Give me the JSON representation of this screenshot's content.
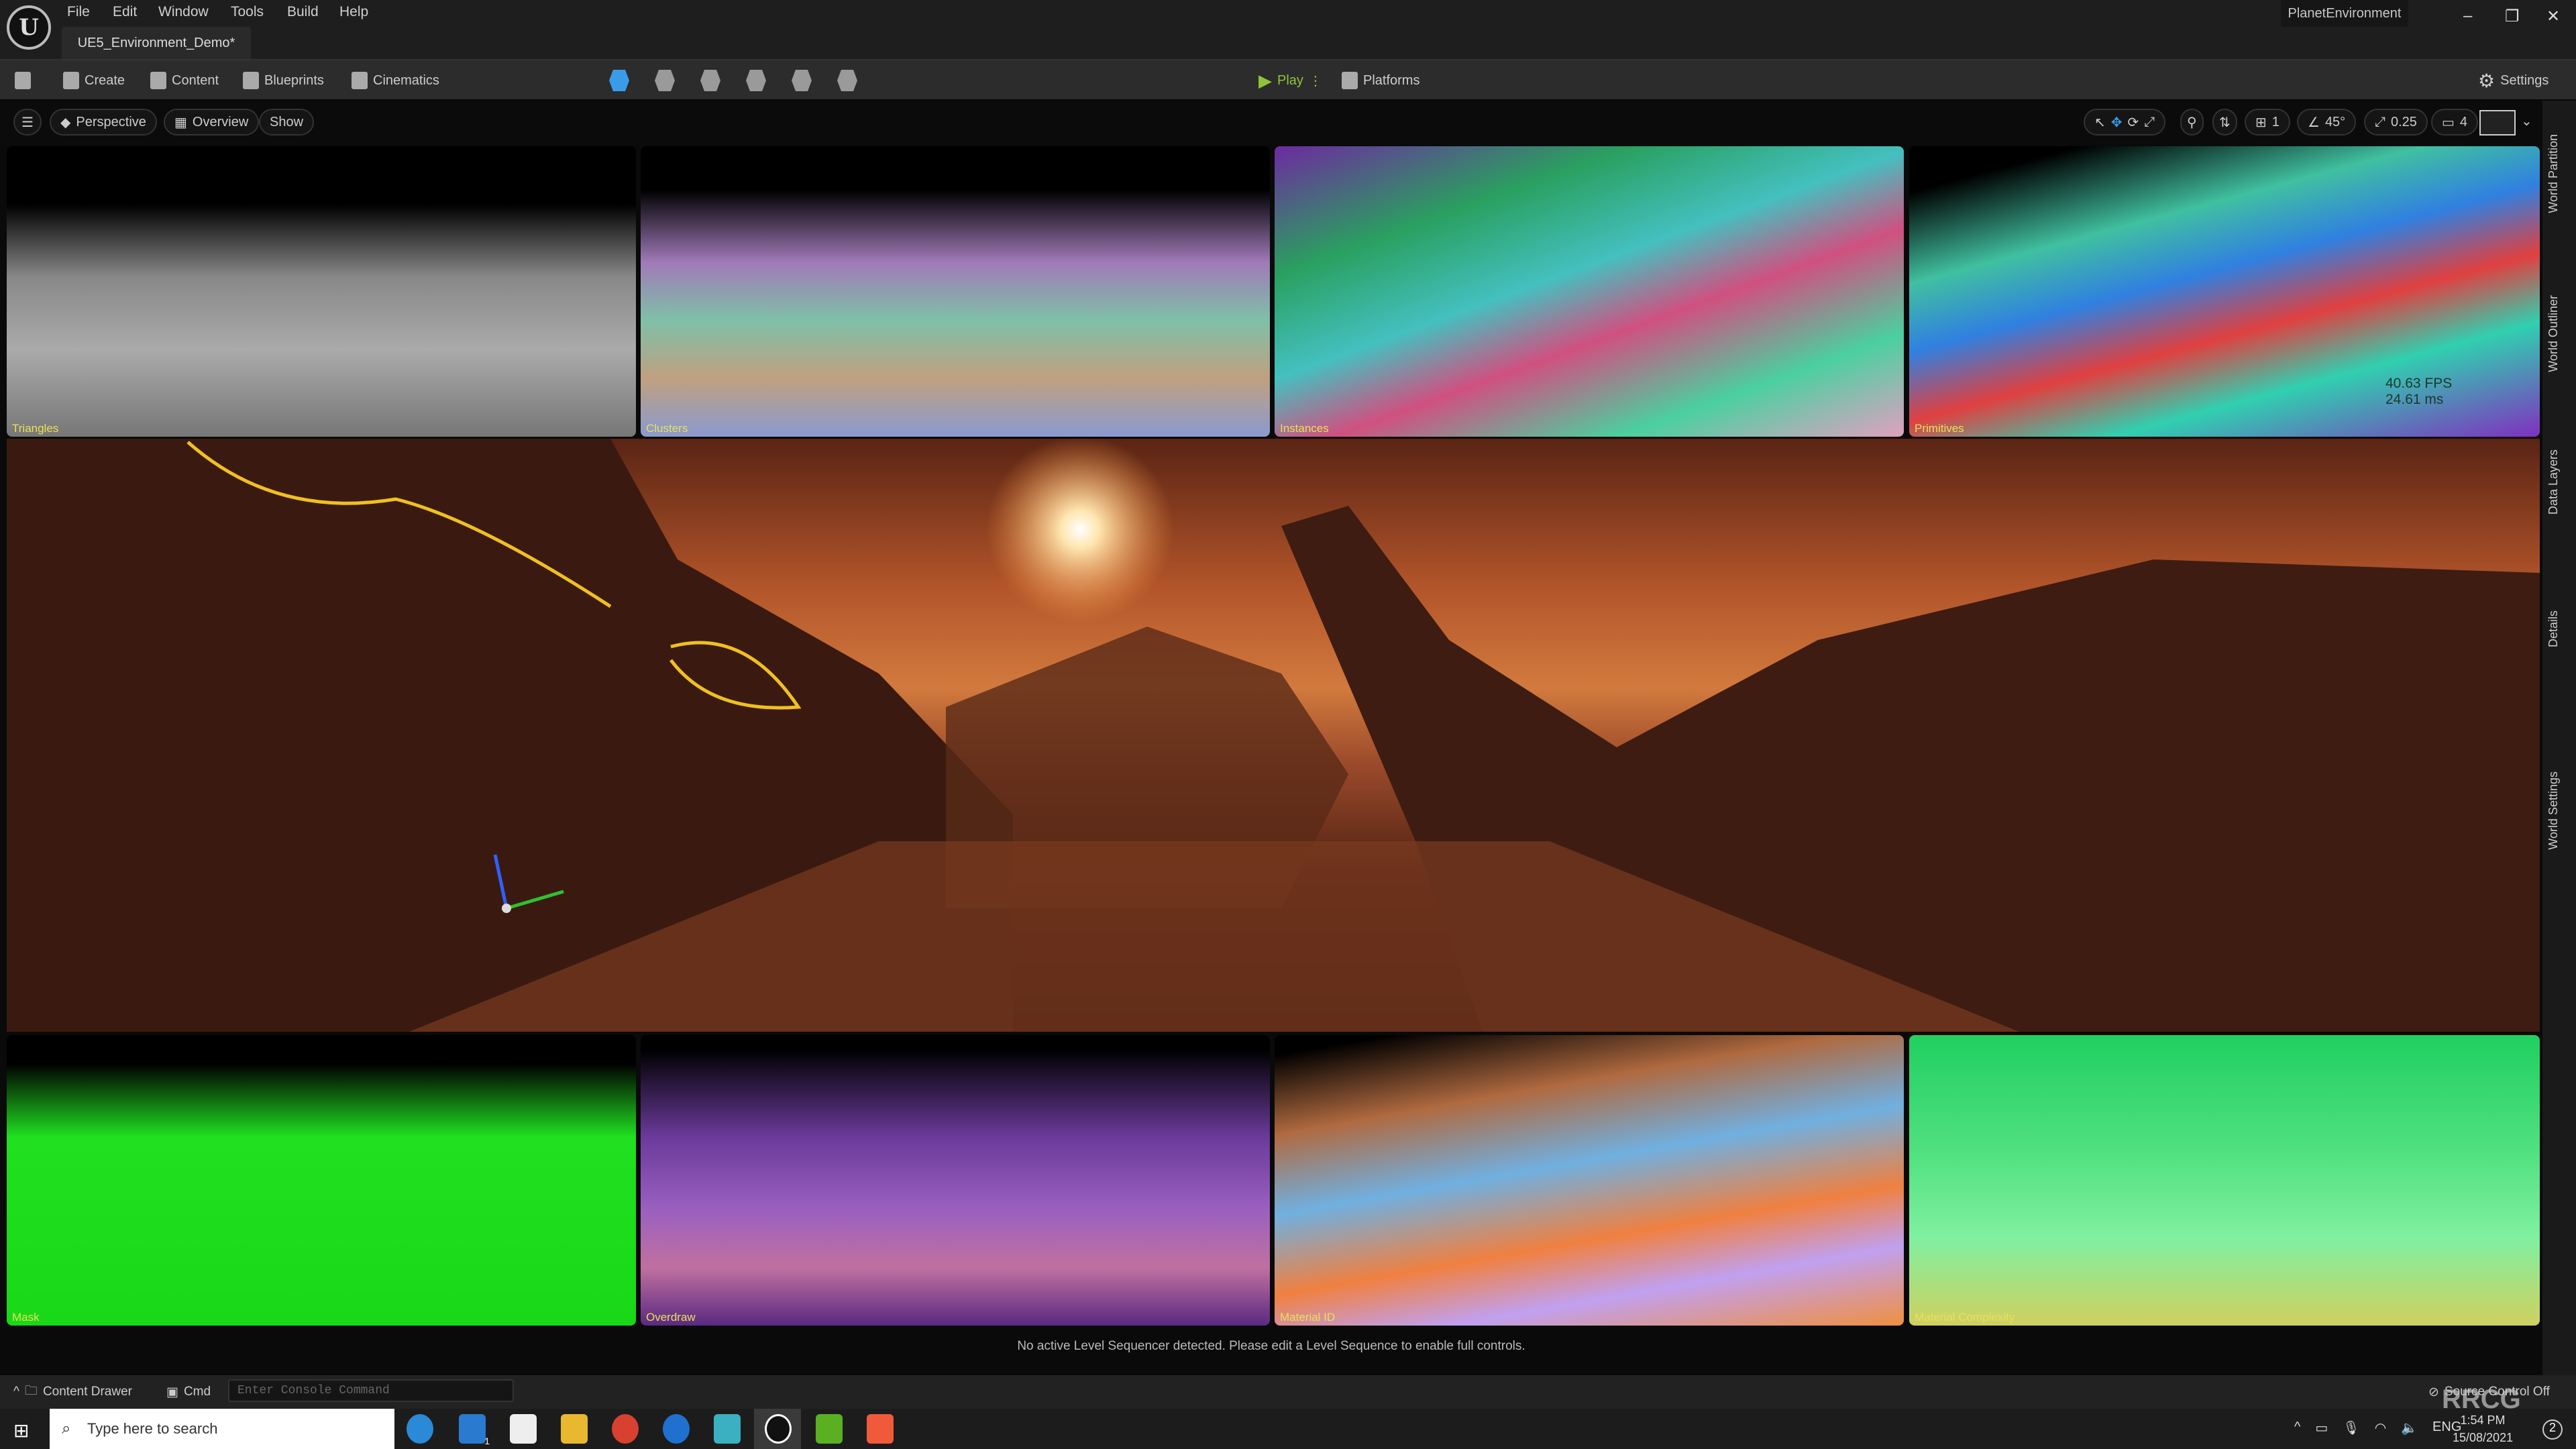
{
  "titlebar": {
    "menu": [
      "File",
      "Edit",
      "Window",
      "Tools",
      "Build",
      "Help"
    ],
    "doc_tab": "UE5_Environment_Demo*",
    "project": "PlanetEnvironment",
    "window_controls": [
      "–",
      "❐",
      "✕"
    ]
  },
  "toolbar": {
    "create": "Create",
    "content": "Content",
    "blueprints": "Blueprints",
    "cinematics": "Cinematics",
    "play": "Play",
    "platforms": "Platforms",
    "settings": "Settings",
    "play_color": "#8fc43a"
  },
  "viewport_toolbar": {
    "perspective": "Perspective",
    "overview": "Overview",
    "show": "Show",
    "grid_snap": "1",
    "rotation_snap": "45°",
    "scale_snap": "0.25",
    "camera_speed": "4"
  },
  "views": {
    "top": [
      "Triangles",
      "Clusters",
      "Instances",
      "Primitives"
    ],
    "bottom": [
      "Mask",
      "Overdraw",
      "Material ID",
      "Material Complexity"
    ]
  },
  "stats": {
    "fps": "40.63 FPS",
    "ms": "24.61 ms"
  },
  "status_message": "No active Level Sequencer detected. Please edit a Level Sequence to enable full controls.",
  "side_tabs": [
    "World Partition",
    "World Outliner",
    "Data Layers",
    "Details",
    "World Settings"
  ],
  "bottom_bar": {
    "content_drawer": "Content Drawer",
    "cmd": "Cmd",
    "console_placeholder": "Enter Console Command",
    "source_control": "Source Control Off"
  },
  "taskbar": {
    "search_placeholder": "Type here to search",
    "language": "ENG",
    "time": "1:54 PM",
    "date": "15/08/2021",
    "notifications": "2",
    "mail_badge": "1"
  },
  "watermark": "RRCG 人人素材"
}
